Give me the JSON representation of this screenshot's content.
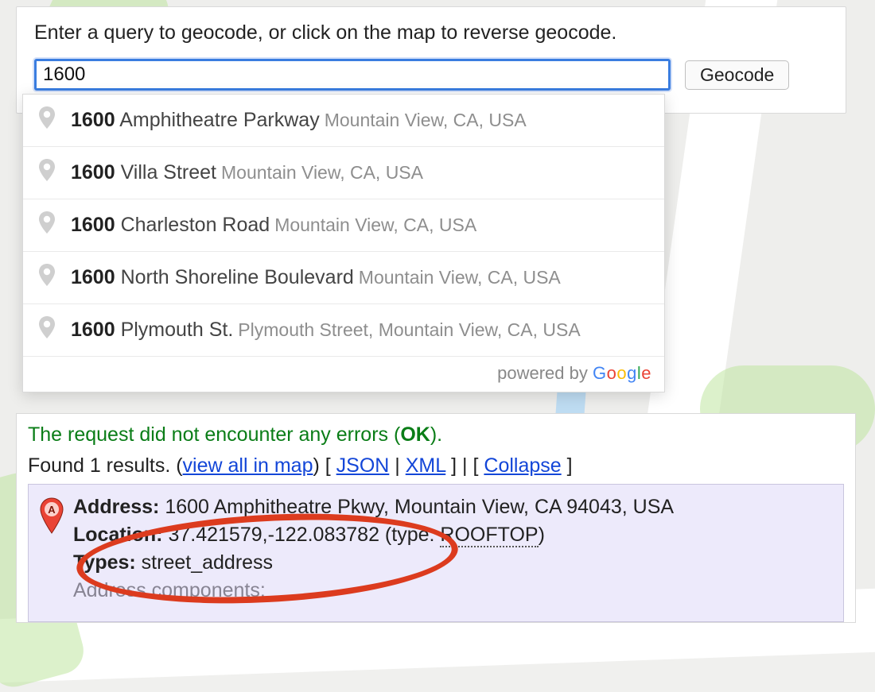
{
  "panel": {
    "instruction": "Enter a query to geocode, or click on the map to reverse geocode.",
    "query_value": "1600",
    "geocode_label": "Geocode"
  },
  "autocomplete": {
    "powered_prefix": "powered by ",
    "items": [
      {
        "match": "1600",
        "main_rest": " Amphitheatre Parkway",
        "secondary": "Mountain View, CA, USA"
      },
      {
        "match": "1600",
        "main_rest": " Villa Street",
        "secondary": "Mountain View, CA, USA"
      },
      {
        "match": "1600",
        "main_rest": " Charleston Road",
        "secondary": "Mountain View, CA, USA"
      },
      {
        "match": "1600",
        "main_rest": " North Shoreline Boulevard",
        "secondary": "Mountain View, CA, USA"
      },
      {
        "match": "1600",
        "main_rest": " Plymouth St.",
        "secondary": "Plymouth Street, Mountain View, CA, USA"
      }
    ]
  },
  "results": {
    "status_prefix": "The request did not encounter any errors (",
    "status_code": "OK",
    "status_suffix": ").",
    "found_prefix": "Found 1 results. (",
    "link_viewall": "view all in map",
    "mid1": ") [ ",
    "link_json": "JSON",
    "pipe": " | ",
    "link_xml": "XML",
    "mid2": " ] | [ ",
    "link_collapse": "Collapse",
    "mid3": " ]",
    "card": {
      "address_label": "Address:",
      "address_value": " 1600 Amphitheatre Pkwy, Mountain View, CA 94043, USA",
      "location_label": "Location:",
      "location_value": " 37.421579,-122.083782 ",
      "type_open": "(type: ",
      "location_type": "ROOFTOP",
      "type_close": ")",
      "types_label": "Types:",
      "types_value": " street_address",
      "components_label": "Address components:"
    }
  }
}
